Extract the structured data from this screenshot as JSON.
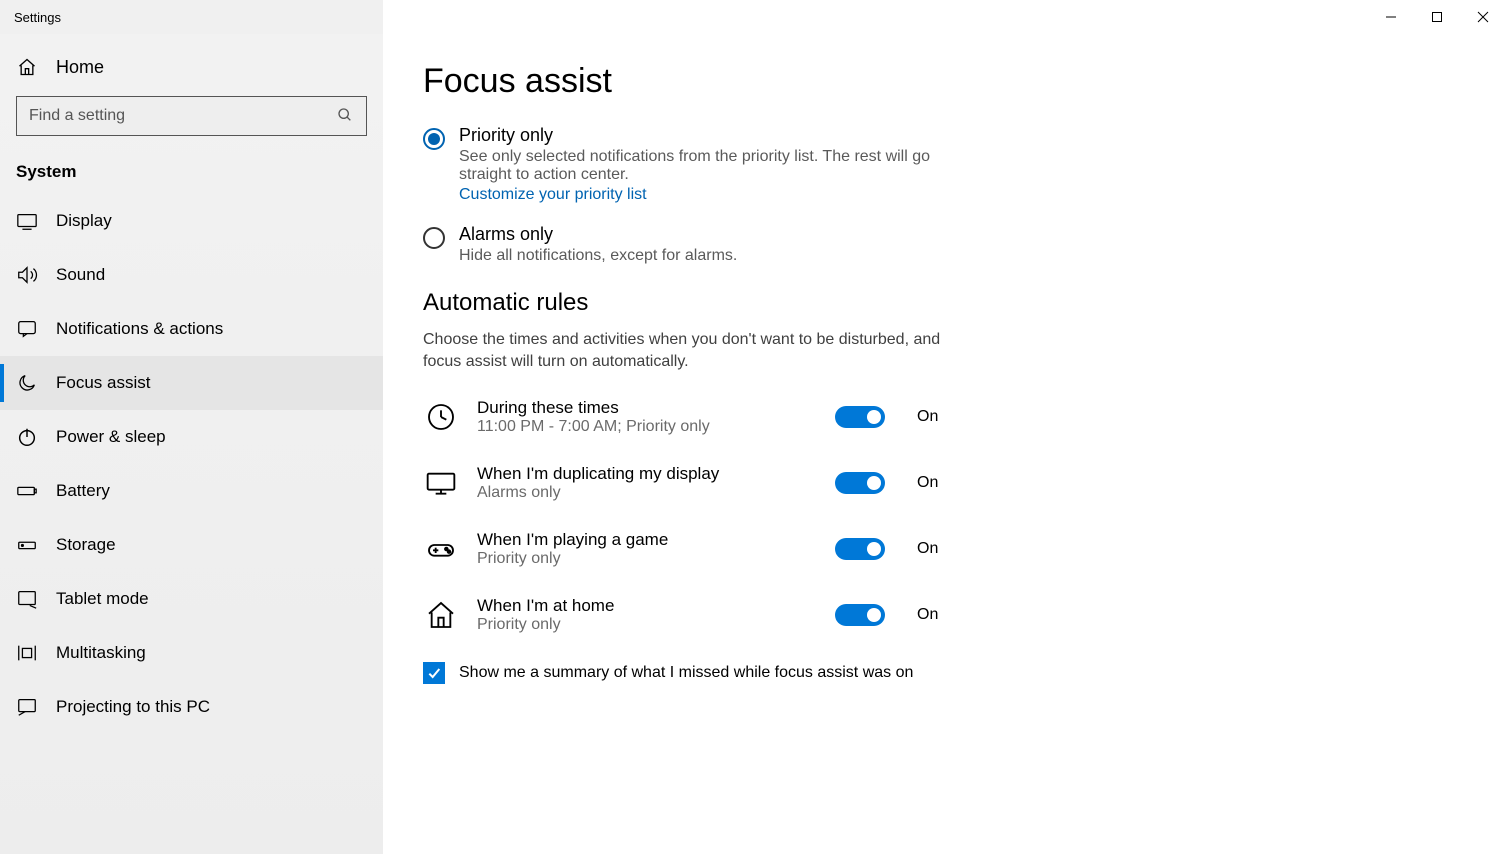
{
  "window": {
    "title": "Settings"
  },
  "sidebar": {
    "home": "Home",
    "search_placeholder": "Find a setting",
    "section": "System",
    "items": [
      {
        "label": "Display"
      },
      {
        "label": "Sound"
      },
      {
        "label": "Notifications & actions"
      },
      {
        "label": "Focus assist"
      },
      {
        "label": "Power & sleep"
      },
      {
        "label": "Battery"
      },
      {
        "label": "Storage"
      },
      {
        "label": "Tablet mode"
      },
      {
        "label": "Multitasking"
      },
      {
        "label": "Projecting to this PC"
      }
    ]
  },
  "page": {
    "title": "Focus assist",
    "radios": {
      "priority": {
        "title": "Priority only",
        "desc": "See only selected notifications from the priority list. The rest will go straight to action center.",
        "link": "Customize your priority list"
      },
      "alarms": {
        "title": "Alarms only",
        "desc": "Hide all notifications, except for alarms."
      }
    },
    "auto": {
      "head": "Automatic rules",
      "desc": "Choose the times and activities when you don't want to be disturbed, and focus assist will turn on automatically."
    },
    "rules": [
      {
        "title": "During these times",
        "sub": "11:00 PM - 7:00 AM; Priority only",
        "state": "On"
      },
      {
        "title": "When I'm duplicating my display",
        "sub": "Alarms only",
        "state": "On"
      },
      {
        "title": "When I'm playing a game",
        "sub": "Priority only",
        "state": "On"
      },
      {
        "title": "When I'm at home",
        "sub": "Priority only",
        "state": "On"
      }
    ],
    "summary_check": "Show me a summary of what I missed while focus assist was on"
  }
}
